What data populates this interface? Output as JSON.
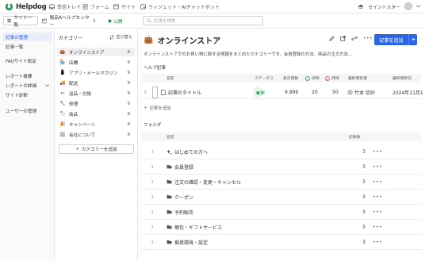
{
  "app": {
    "logo_text": "Helpdog",
    "nav": [
      {
        "label": "受信トレイ",
        "icon": "inbox-icon"
      },
      {
        "label": "フォーム",
        "icon": "form-icon"
      },
      {
        "label": "サイト",
        "icon": "site-icon"
      },
      {
        "label": "ウィジェット・AIチャットボット",
        "icon": "widget-icon"
      }
    ],
    "user_name": "セイントスター"
  },
  "subbar": {
    "site_list": "サイト一覧",
    "site_name": "製品Aヘルプセンター",
    "public_status": "公開",
    "search_placeholder": "記事を検索"
  },
  "sidebar": {
    "items": [
      {
        "label": "記事の管理",
        "active": true
      },
      {
        "label": "記事一覧",
        "active": false
      },
      {
        "label": "FAQサイト設定",
        "active": false
      },
      {
        "label": "レポート概要",
        "active": false
      },
      {
        "label": "レポートの詳細",
        "active": false
      },
      {
        "label": "サイト診断",
        "active": false
      },
      {
        "label": "ユーザーの管理",
        "active": false
      }
    ]
  },
  "categories": {
    "heading": "カテゴリー",
    "sort_label": "並び替え",
    "items": [
      {
        "label": "オンラインストア",
        "count": "9",
        "icon": "👜"
      },
      {
        "label": "店舗",
        "count": "9",
        "icon": "🏪"
      },
      {
        "label": "アプリ・メールマガジン",
        "count": "9",
        "icon": "📱"
      },
      {
        "label": "配送",
        "count": "9",
        "icon": "🚚"
      },
      {
        "label": "返品・交換",
        "count": "9",
        "icon": "↩"
      },
      {
        "label": "修理",
        "count": "9",
        "icon": "🔧"
      },
      {
        "label": "商品",
        "count": "9",
        "icon": "🏷"
      },
      {
        "label": "キャンペーン",
        "count": "9",
        "icon": "🎉"
      },
      {
        "label": "会社について",
        "count": "9",
        "icon": "🏢"
      }
    ],
    "add_label": "カテゴリーを追加"
  },
  "main": {
    "title": "オンラインストア",
    "add_article_label": "記事を追加",
    "description": "オンラインストアでのお買い物に関する情報をまとめたカテゴリーです。会員登録の方法、商品の注文方法...",
    "help_section_label": "ヘルプ記事",
    "article_columns": {
      "name": "名前",
      "status": "ステータス",
      "views": "表示回数",
      "good": "評価",
      "bad": "評価",
      "updater": "最終更新者",
      "updated": "最終更新日"
    },
    "articles": [
      {
        "name": "記事のタイトル",
        "status": "公開",
        "views": "9,999",
        "good": "20",
        "bad": "50",
        "updater": "竹本 信好",
        "updated": "2024年11月1"
      }
    ],
    "add_article_row": "記事を追加",
    "folder_section_label": "フォルダ",
    "folder_columns": {
      "name": "名前",
      "count": "記事数"
    },
    "folders": [
      {
        "name": "はじめての方へ",
        "count": "3",
        "icon": "sparkle-icon"
      },
      {
        "name": "会員登録",
        "count": "3",
        "icon": "folder-icon"
      },
      {
        "name": "注文の確認・変更・キャンセル",
        "count": "3",
        "icon": "folder-icon"
      },
      {
        "name": "クーポン",
        "count": "3",
        "icon": "folder-icon"
      },
      {
        "name": "予約販売",
        "count": "3",
        "icon": "folder-icon"
      },
      {
        "name": "梱包・ギフトサービス",
        "count": "3",
        "icon": "folder-icon"
      },
      {
        "name": "推奨環境・設定",
        "count": "3",
        "icon": "folder-icon"
      }
    ]
  },
  "colors": {
    "accent": "#2b67e0",
    "public_green": "#1a9950",
    "good_green": "#1a9950",
    "bad_red": "#e04040"
  }
}
